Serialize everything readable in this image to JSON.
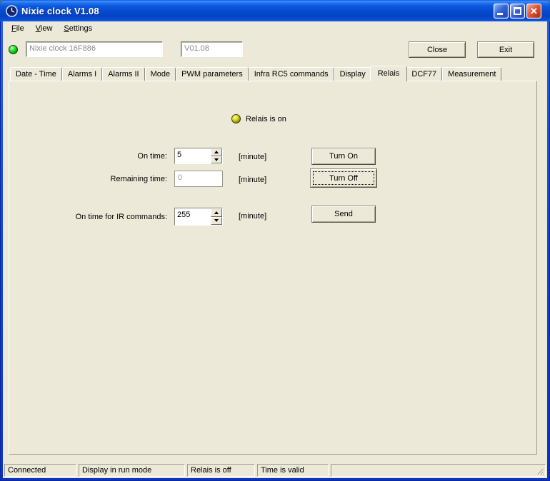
{
  "window": {
    "title": "Nixie clock V1.08"
  },
  "menu": {
    "items": [
      {
        "label": "File"
      },
      {
        "label": "View"
      },
      {
        "label": "Settings"
      }
    ]
  },
  "header": {
    "device_name": "Nixie clock 16F886",
    "firmware_version": "V01.08",
    "close_button": "Close",
    "exit_button": "Exit"
  },
  "tabs": {
    "selected": "Relais",
    "items": [
      "Date - Time",
      "Alarms I",
      "Alarms II",
      "Mode",
      "PWM parameters",
      "Infra RC5 commands",
      "Display",
      "Relais",
      "DCF77",
      "Measurement"
    ]
  },
  "relais_tab": {
    "status_text": "Relais is on",
    "on_time": {
      "label": "On time:",
      "value": "5",
      "unit": "[minute]"
    },
    "remaining_time": {
      "label": "Remaining time:",
      "value": "0",
      "unit": "[minute]"
    },
    "ir_on_time": {
      "label": "On time for IR commands:",
      "value": "255",
      "unit": "[minute]"
    },
    "buttons": {
      "turn_on": "Turn On",
      "turn_off": "Turn Off",
      "send": "Send"
    }
  },
  "status_bar": {
    "panels": [
      "Connected",
      "Display in run mode",
      "Relais is off",
      "Time is valid"
    ]
  },
  "colors": {
    "titlebar_blue": "#0b57dd",
    "window_border_blue": "#1747cf",
    "client_bg": "#ece9d8",
    "close_button_red": "#d84a2c",
    "connection_led_green": "#22cc22",
    "relais_led_olive": "#a8a800"
  }
}
